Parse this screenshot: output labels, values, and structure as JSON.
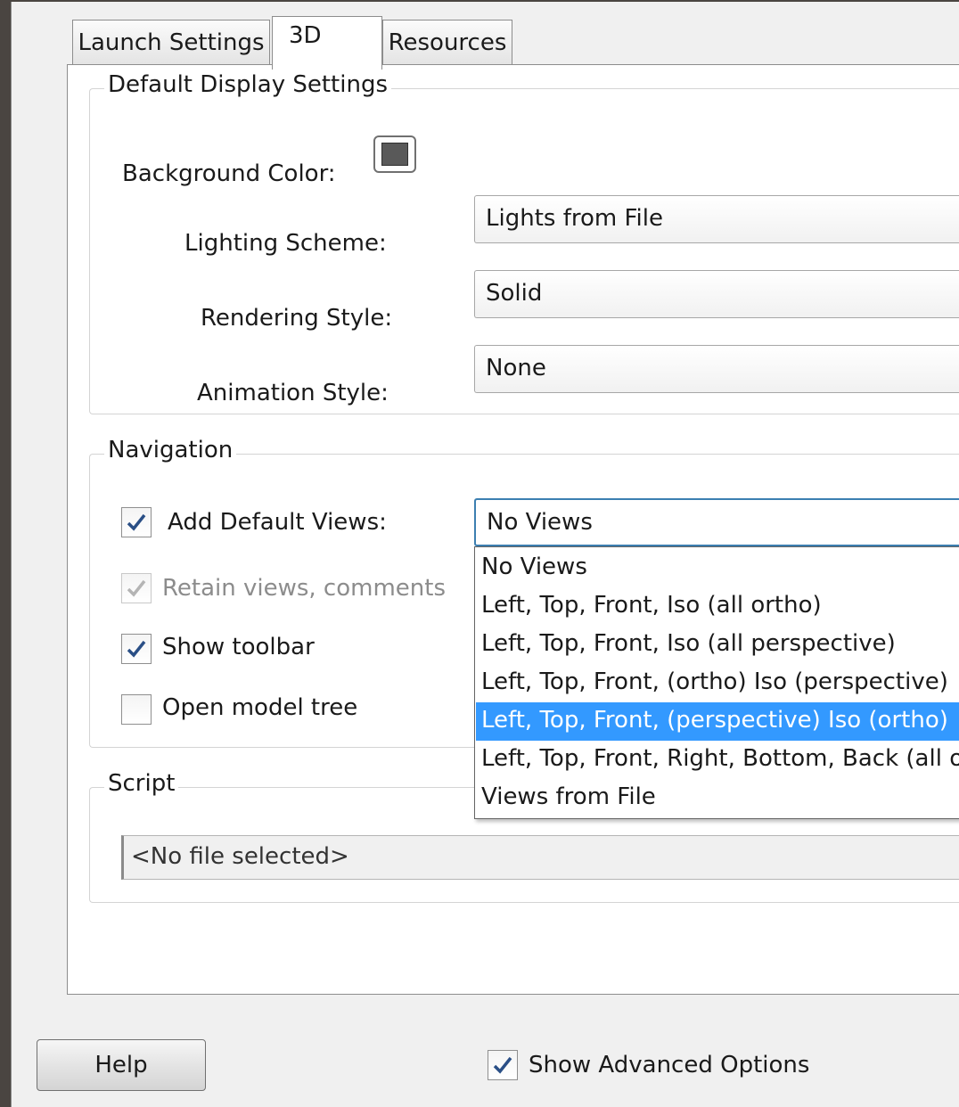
{
  "tabs": [
    {
      "label": "Launch Settings",
      "active": false
    },
    {
      "label": "3D",
      "active": true
    },
    {
      "label": "Resources",
      "active": false
    }
  ],
  "display_group": {
    "legend": "Default Display Settings",
    "background_color_label": "Background Color:",
    "background_color_value": "#595959",
    "lighting_label": "Lighting Scheme:",
    "lighting_value": "Lights from File",
    "rendering_label": "Rendering Style:",
    "rendering_value": "Solid",
    "animation_label": "Animation Style:",
    "animation_value": "None"
  },
  "navigation_group": {
    "legend": "Navigation",
    "add_default_views_label": "Add Default Views:",
    "add_default_views_checked": true,
    "add_default_views_value": "No Views",
    "retain_views_label": "Retain views, comments",
    "retain_views_checked": true,
    "retain_views_enabled": false,
    "show_toolbar_label": "Show toolbar",
    "show_toolbar_checked": true,
    "open_model_tree_label": "Open model tree",
    "open_model_tree_checked": false
  },
  "views_dropdown": {
    "options": [
      "No Views",
      "Left, Top, Front, Iso (all ortho)",
      "Left, Top, Front, Iso (all perspective)",
      "Left, Top, Front, (ortho) Iso (perspective)",
      "Left, Top, Front, (perspective) Iso (ortho)",
      "Left, Top, Front, Right, Bottom, Back (all ortho)",
      "Views from File"
    ],
    "highlighted_option": "Left, Top, Front, (perspective) Iso (ortho)"
  },
  "script_group": {
    "legend": "Script",
    "file_value": "<No file selected>"
  },
  "footer": {
    "help_label": "Help",
    "show_advanced_label": "Show Advanced Options",
    "show_advanced_checked": true
  },
  "colors": {
    "selection": "#3399ff",
    "focus_border": "#3c7fb1",
    "check_mark": "#2a4f86"
  }
}
